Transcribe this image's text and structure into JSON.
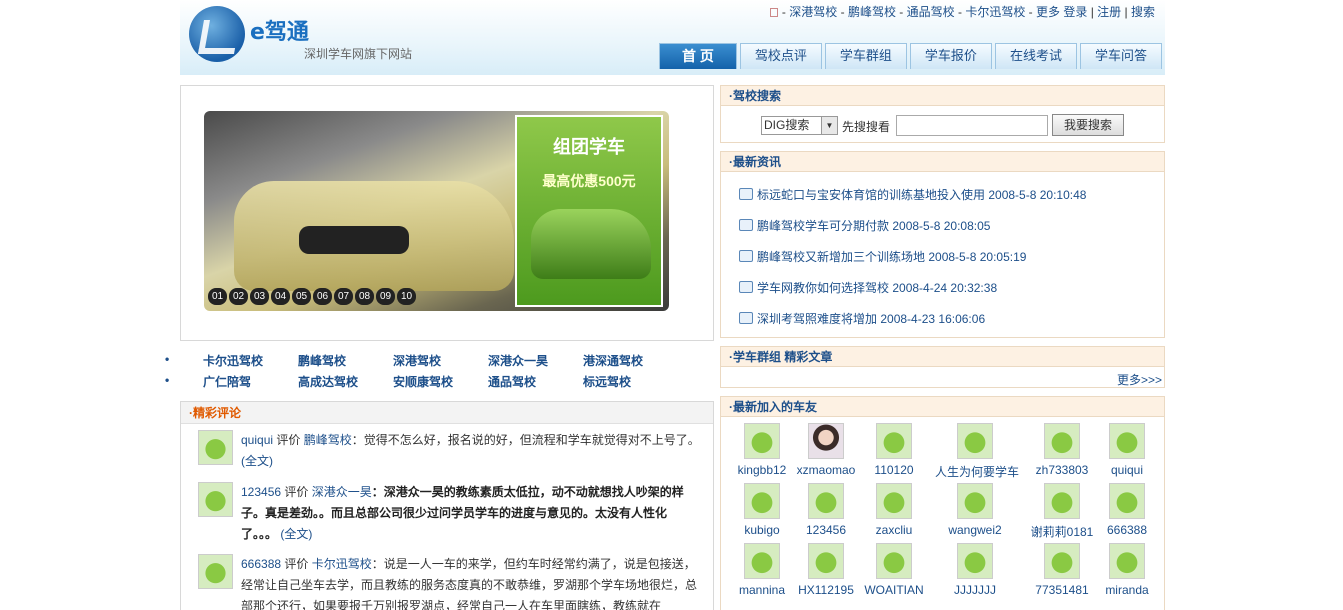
{
  "header": {
    "logo_text": "e驾通",
    "tagline": "深圳学车网旗下网站",
    "top_links": [
      "深港驾校",
      "鹏峰驾校",
      "通品驾校",
      "卡尔迅驾校",
      "更多"
    ],
    "login": "登录",
    "register": "注册",
    "search": "搜索",
    "nav": [
      "首 页",
      "驾校点评",
      "学车群组",
      "学车报价",
      "在线考试",
      "学车问答"
    ]
  },
  "banner": {
    "promo_title": "组团学车",
    "promo_sub": "最高优惠500元",
    "numbers": [
      "01",
      "02",
      "03",
      "04",
      "05",
      "06",
      "07",
      "08",
      "09",
      "10"
    ]
  },
  "school_links": [
    [
      "卡尔迅驾校",
      "鹏峰驾校",
      "深港驾校",
      "深港众一昊",
      "港深通驾校"
    ],
    [
      "广仁陪驾",
      "高成达驾校",
      "安顺康驾校",
      "通品驾校",
      "标远驾校"
    ]
  ],
  "comments": {
    "title": "·精彩评论",
    "items": [
      {
        "user": "quiqui",
        "verb": "评价",
        "school": "鹏峰驾校",
        "text": "：觉得不怎么好，报名说的好，但流程和学车就觉得对不上号了。",
        "more": "(全文)"
      },
      {
        "user": "123456",
        "verb": "评价",
        "school": "深港众一昊",
        "text": "：深港众一昊的教练素质太低拉，动不动就想找人吵架的样子。真是差劲。。而且总部公司很少过问学员学车的进度与意见的。太没有人性化了。。。",
        "more": "(全文)"
      },
      {
        "user": "666388",
        "verb": "评价",
        "school": "卡尔迅驾校",
        "text": "：说是一人一车的来学，但约车时经常约满了，说是包接送，经常让自己坐车去学，而且教练的服务态度真的不敢恭维，罗湖那个学车场地很烂，总部那个还行，如果要报千万别报罗湖点，经常自己一人在车里面瞎练，教练就在"
      }
    ]
  },
  "search_box": {
    "title": "·驾校搜索",
    "select_value": "DIG搜索",
    "hint": "先搜搜看",
    "input_value": "",
    "button": "我要搜索"
  },
  "news": {
    "title": "·最新资讯",
    "items": [
      {
        "title": "标远蛇口与宝安体育馆的训练基地投入使用",
        "date": "2008-5-8 20:10:48"
      },
      {
        "title": "鹏峰驾校学车可分期付款",
        "date": "2008-5-8 20:08:05"
      },
      {
        "title": "鹏峰驾校又新增加三个训练场地",
        "date": "2008-5-8 20:05:19"
      },
      {
        "title": "学车网教你如何选择驾校",
        "date": "2008-4-24 20:32:38"
      },
      {
        "title": "深圳考驾照难度将增加",
        "date": "2008-4-23 16:06:06"
      }
    ]
  },
  "group": {
    "title": "·学车群组 精彩文章",
    "more": "更多>>>"
  },
  "friends": {
    "title": "·最新加入的车友",
    "items": [
      "kingbb12",
      "xzmaomao",
      "110120",
      "人生为何要学车",
      "zh733803",
      "quiqui",
      "kubigo",
      "123456",
      "zaxcliu",
      "wangwei2",
      "谢莉莉0181",
      "666388",
      "mannina",
      "HX112195",
      "WOAITIAN",
      "JJJJJJJ",
      "77351481",
      "miranda"
    ]
  }
}
